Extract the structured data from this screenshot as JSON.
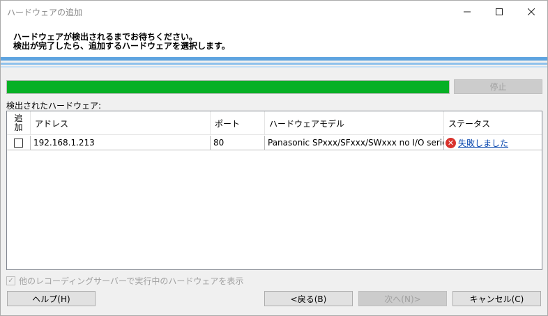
{
  "window": {
    "title": "ハードウェアの追加",
    "minimize_icon": "minimize-icon",
    "maximize_icon": "maximize-icon",
    "close_icon": "close-icon"
  },
  "header": {
    "line1": "ハードウェアが検出されるまでお待ちください。",
    "line2": "検出が完了したら、追加するハードウェアを選択します。"
  },
  "progress": {
    "value_percent": 100,
    "color": "#06b025"
  },
  "stop_button": {
    "label": "停止",
    "enabled": false
  },
  "detected_label": "検出されたハードウェア:",
  "table": {
    "columns": {
      "add": [
        "追",
        "加"
      ],
      "address": "アドレス",
      "port": "ポート",
      "model": "ハードウェアモデル",
      "status": "ステータス"
    },
    "rows": [
      {
        "checked": false,
        "address": "192.168.1.213",
        "port": "80",
        "model": "Panasonic SPxxx/SFxxx/SWxxx no I/O series ca...",
        "status_icon": "error-icon",
        "status": "失敗しました"
      }
    ]
  },
  "show_other": {
    "label": "他のレコーディングサーバーで実行中のハードウェアを表示",
    "checked": true,
    "enabled": false
  },
  "buttons": {
    "help": "ヘルプ(H)",
    "back": "<戻る(B)",
    "next": "次へ(N)>",
    "cancel": "キャンセル(C)"
  }
}
